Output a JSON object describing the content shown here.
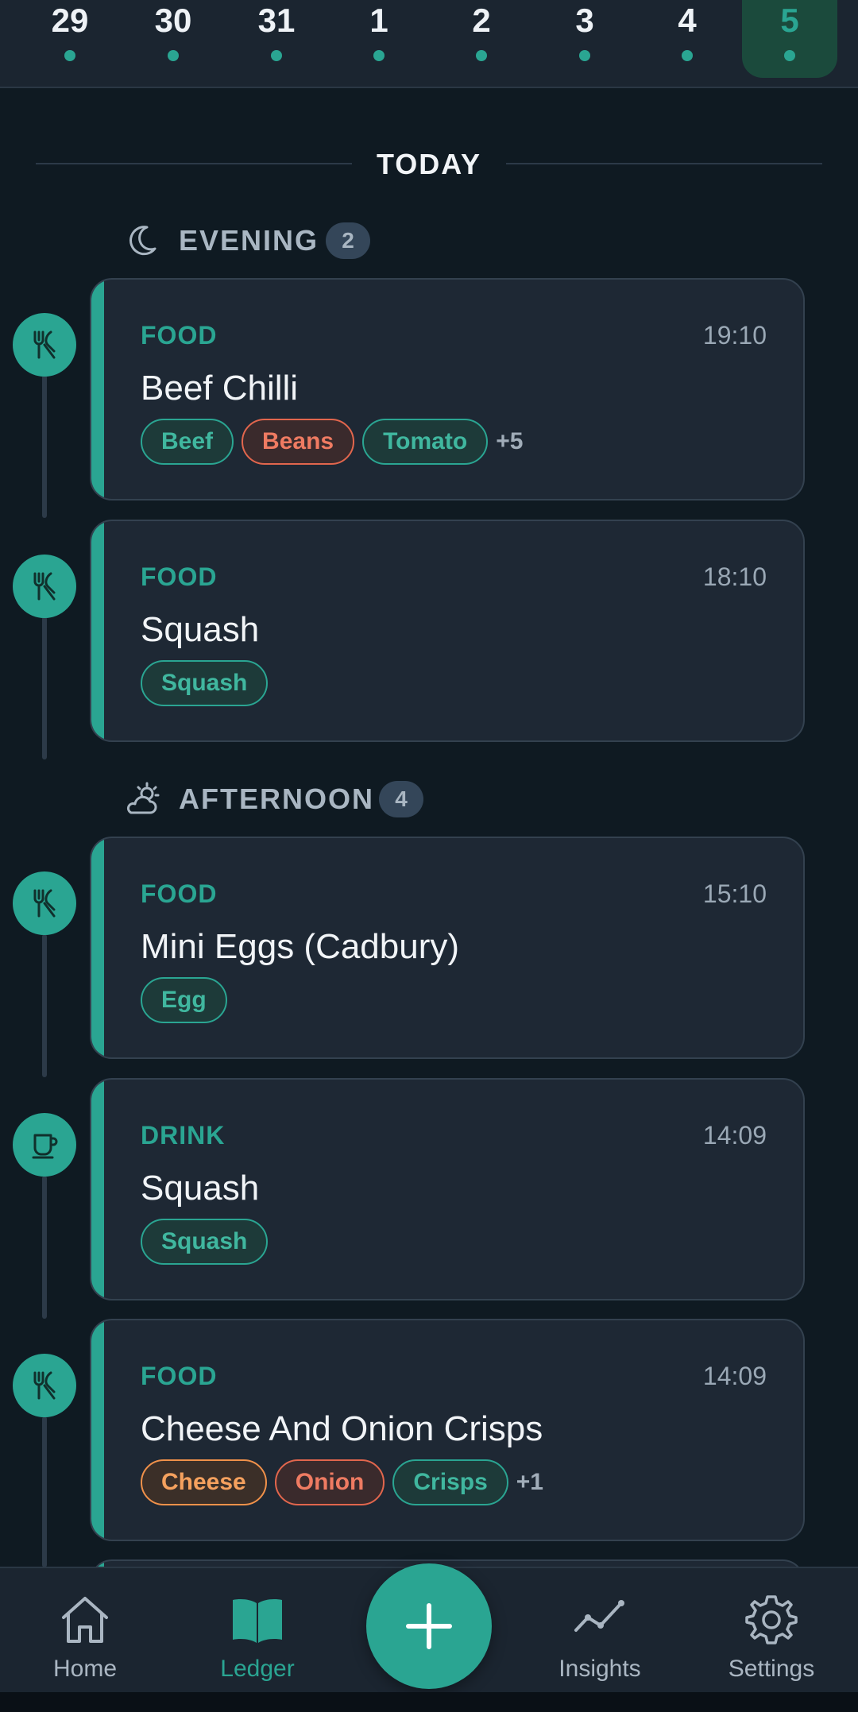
{
  "date_strip": {
    "days": [
      {
        "num": "29",
        "selected": false
      },
      {
        "num": "30",
        "selected": false
      },
      {
        "num": "31",
        "selected": false
      },
      {
        "num": "1",
        "selected": false
      },
      {
        "num": "2",
        "selected": false
      },
      {
        "num": "3",
        "selected": false
      },
      {
        "num": "4",
        "selected": false
      },
      {
        "num": "5",
        "selected": true
      }
    ]
  },
  "today_label": "TODAY",
  "sections": {
    "evening": {
      "title": "EVENING",
      "count": "2",
      "icon": "moon-icon"
    },
    "afternoon": {
      "title": "AFTERNOON",
      "count": "4",
      "icon": "cloud-sun-icon"
    }
  },
  "entries": [
    {
      "category": "FOOD",
      "time": "19:10",
      "name": "Beef Chilli",
      "icon": "utensils-icon",
      "tags": [
        {
          "label": "Beef",
          "tone": "green"
        },
        {
          "label": "Beans",
          "tone": "red"
        },
        {
          "label": "Tomato",
          "tone": "green"
        }
      ],
      "more": "+5"
    },
    {
      "category": "FOOD",
      "time": "18:10",
      "name": "Squash",
      "icon": "utensils-icon",
      "tags": [
        {
          "label": "Squash",
          "tone": "green"
        }
      ],
      "more": ""
    },
    {
      "category": "FOOD",
      "time": "15:10",
      "name": "Mini Eggs (Cadbury)",
      "icon": "utensils-icon",
      "tags": [
        {
          "label": "Egg",
          "tone": "green"
        }
      ],
      "more": ""
    },
    {
      "category": "DRINK",
      "time": "14:09",
      "name": "Squash",
      "icon": "cup-icon",
      "tags": [
        {
          "label": "Squash",
          "tone": "green"
        }
      ],
      "more": ""
    },
    {
      "category": "FOOD",
      "time": "14:09",
      "name": "Cheese And Onion Crisps",
      "icon": "utensils-icon",
      "tags": [
        {
          "label": "Cheese",
          "tone": "orange"
        },
        {
          "label": "Onion",
          "tone": "red"
        },
        {
          "label": "Crisps",
          "tone": "green"
        }
      ],
      "more": "+1"
    }
  ],
  "bottom_nav": {
    "home": "Home",
    "ledger": "Ledger",
    "insights": "Insights",
    "settings": "Settings",
    "active": "ledger",
    "fab_icon": "plus-icon"
  },
  "colors": {
    "accent": "#2aa592",
    "background": "#0f1a22",
    "card": "#1e2834",
    "tag_red": "#e2664d",
    "tag_orange": "#f0914a"
  }
}
